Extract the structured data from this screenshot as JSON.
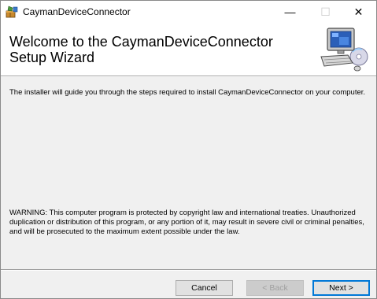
{
  "window": {
    "title": "CaymanDeviceConnector",
    "controls": {
      "minimize_glyph": "—",
      "maximize_glyph": "☐",
      "close_glyph": "✕"
    }
  },
  "header": {
    "title": "Welcome to the CaymanDeviceConnector Setup Wizard",
    "art_icon": "computer-setup-icon"
  },
  "content": {
    "intro": "The installer will guide you through the steps required to install CaymanDeviceConnector on your computer.",
    "warning": "WARNING: This computer program is protected by copyright law and international treaties. Unauthorized duplication or distribution of this program, or any portion of it, may result in severe civil or criminal penalties, and will be prosecuted to the maximum extent possible under the law."
  },
  "buttons": {
    "cancel": "Cancel",
    "back": "< Back",
    "next": "Next >"
  },
  "colors": {
    "accent": "#0078d7",
    "disabled_text": "#a0a0a0"
  }
}
